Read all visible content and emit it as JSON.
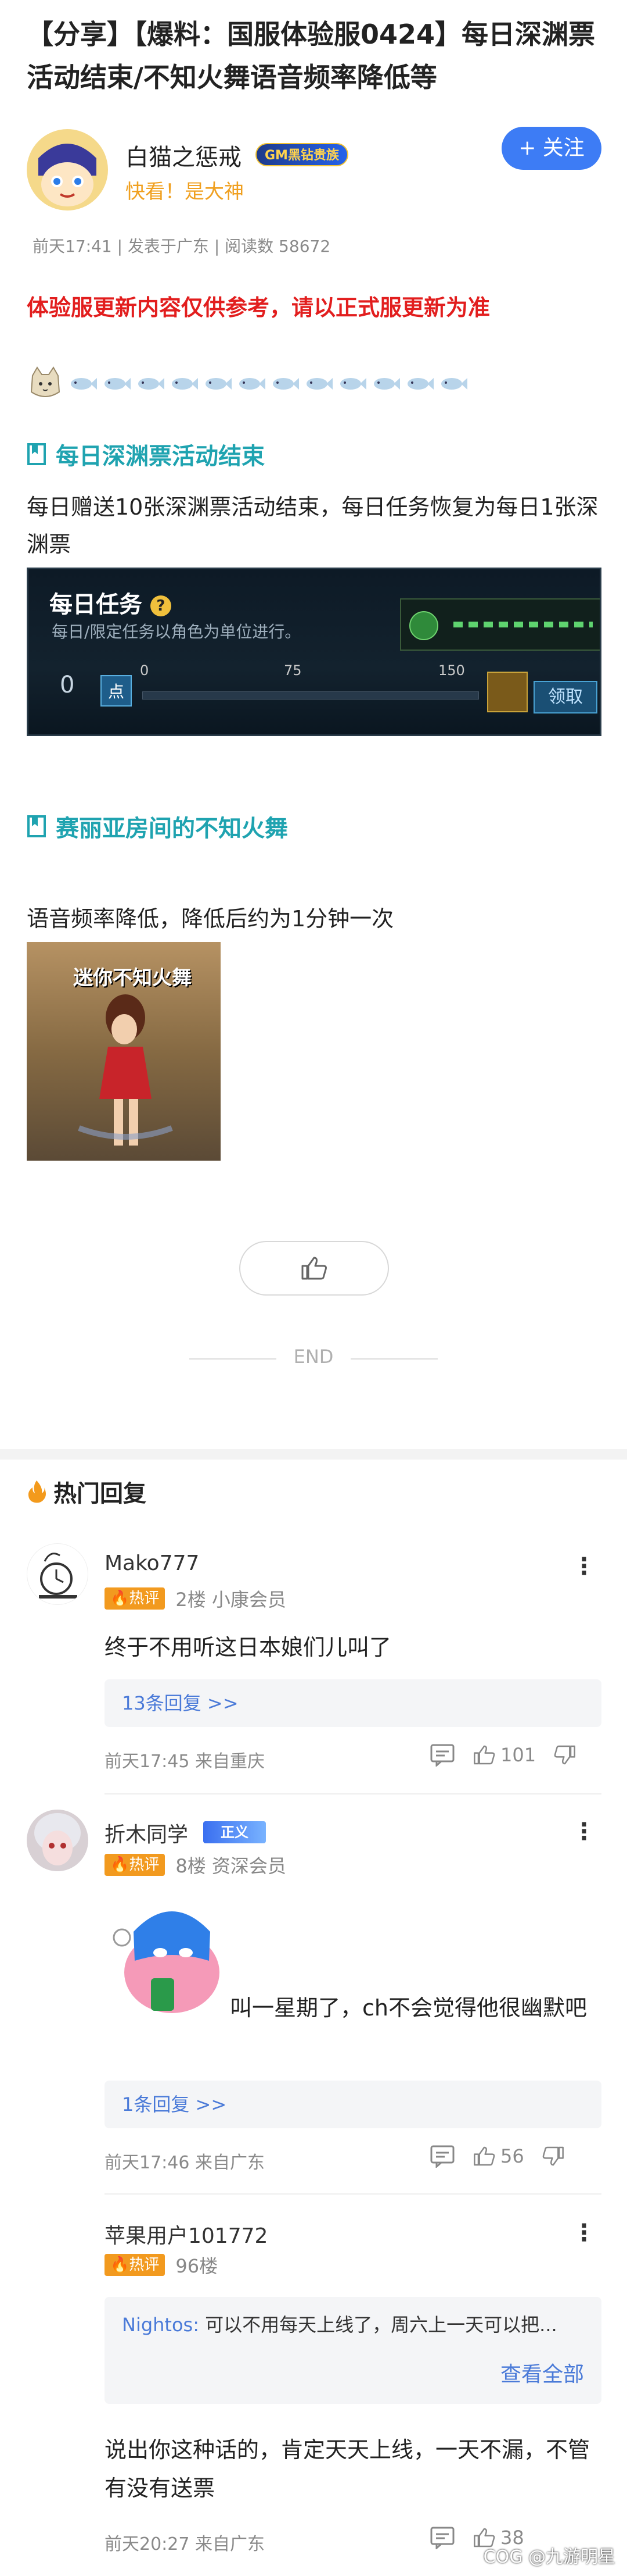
{
  "post": {
    "title": "【分享】【爆料：国服体验服0424】每日深渊票活动结束/不知火舞语音频率降低等",
    "author": {
      "name": "白猫之惩戒",
      "badge": "GM黑钻贵族",
      "subtitle": "快看！是大神"
    },
    "follow_label": "+ 关注",
    "meta": "前天17:41 | 发表于广东 | 阅读数 58672",
    "notice": "体验服更新内容仅供参考，请以正式服更新为准",
    "sections": [
      {
        "heading": "每日深渊票活动结束",
        "text": "每日赠送10张深渊票活动结束，每日任务恢复为每日1张深渊票",
        "image": {
          "title": "每日任务",
          "subtitle": "每日/限定任务以角色为单位进行。",
          "zero": "0",
          "box_label": "点",
          "ticks": [
            "0",
            "75",
            "150"
          ],
          "button": "领取"
        }
      },
      {
        "heading": "赛丽亚房间的不知火舞",
        "text": "语音频率降低，降低后约为1分钟一次",
        "image": {
          "caption": "迷你不知火舞"
        }
      }
    ],
    "end_label": "END"
  },
  "hot_replies": {
    "title": "热门回复",
    "hot_tag": "热评",
    "comments": [
      {
        "name": "Mako777",
        "floor": "2楼 小康会员",
        "text": "终于不用听这日本娘们儿叫了",
        "reply_link": "13条回复 >>",
        "time": "前天17:45 来自重庆",
        "likes": "101"
      },
      {
        "name": "折木同学",
        "name_badge": "正义",
        "floor": "8楼 资深会员",
        "text": "叫一星期了，ch不会觉得他很幽默吧",
        "reply_link": "1条回复 >>",
        "time": "前天17:46 来自广东",
        "likes": "56"
      },
      {
        "name": "苹果用户101772",
        "floor": "96楼",
        "quote_user": "Nightos:",
        "quote_text": "可以不用每天上线了，周六上一天可以把...",
        "view_all": "查看全部",
        "text": "说出你这种话的，肯定天天上线，一天不漏，不管有没有送票",
        "time": "前天20:27 来自广东",
        "likes": "38"
      }
    ]
  },
  "watermark": "COG @九游明星"
}
